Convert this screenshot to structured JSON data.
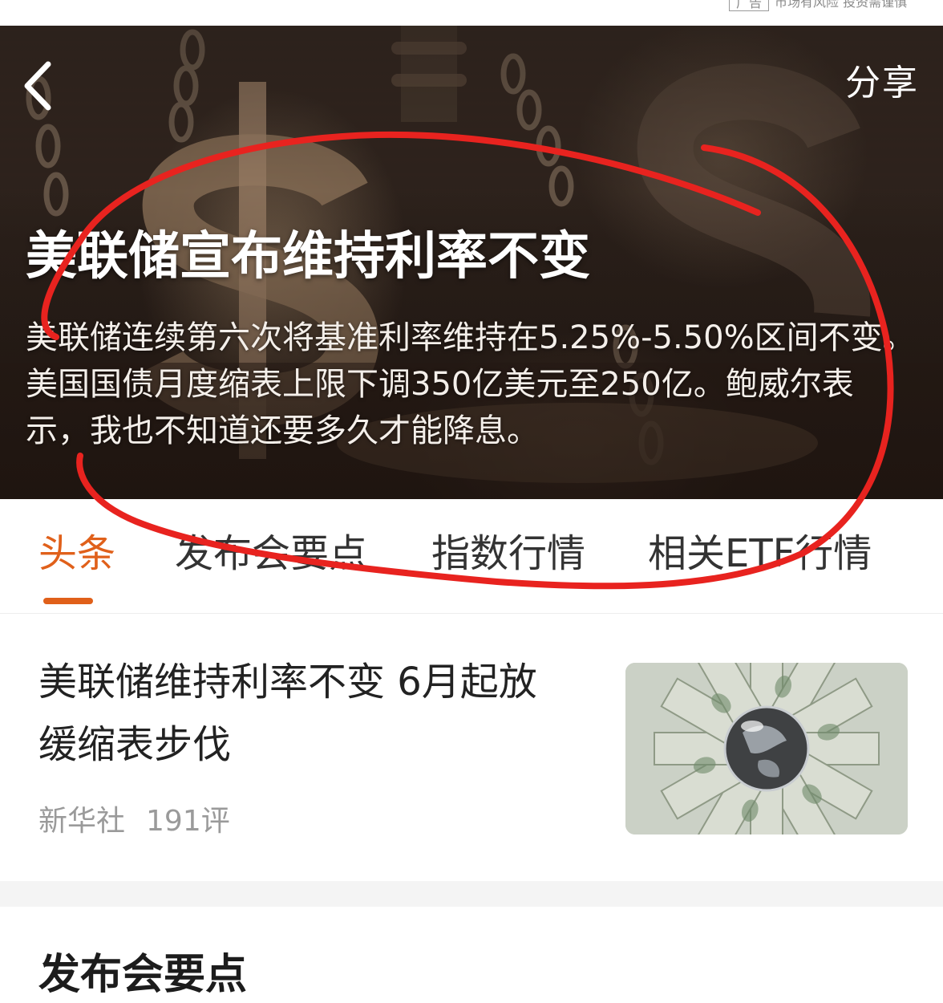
{
  "ad": {
    "badge": "广告",
    "notice": "市场有风险  投资需谨慎"
  },
  "header": {
    "back_icon": "chevron-left-icon",
    "share_label": "分享"
  },
  "hero": {
    "title": "美联储宣布维持利率不变",
    "description": "美联储连续第六次将基准利率维持在5.25%-5.50%区间不变。美国国债月度缩表上限下调350亿美元至250亿。鲍威尔表示，我也不知道还要多久才能降息。"
  },
  "tabs": [
    {
      "label": "头条",
      "active": true
    },
    {
      "label": "发布会要点",
      "active": false
    },
    {
      "label": "指数行情",
      "active": false
    },
    {
      "label": "相关ETF行情",
      "active": false
    }
  ],
  "news": {
    "title": "美联储维持利率不变 6月起放缓缩表步伐",
    "source": "新华社",
    "comments": "191评"
  },
  "section": {
    "heading": "发布会要点"
  },
  "colors": {
    "accent": "#e0601a",
    "annotation_stroke": "#e8231f"
  }
}
